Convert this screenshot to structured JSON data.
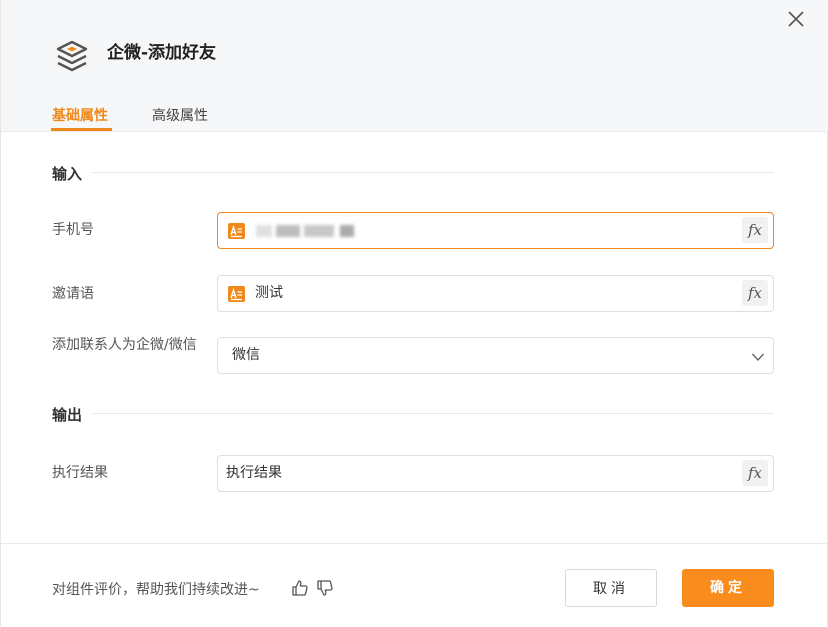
{
  "dialog": {
    "title": "企微-添加好友",
    "tabs": [
      {
        "label": "基础属性",
        "active": true
      },
      {
        "label": "高级属性",
        "active": false
      }
    ]
  },
  "input_section": {
    "title": "输入",
    "fields": [
      {
        "label": "手机号",
        "value": "",
        "redacted": true
      },
      {
        "label": "邀请语",
        "value": "测试"
      },
      {
        "label": "添加联系人为企微/微信",
        "selected": "微信"
      }
    ]
  },
  "output_section": {
    "title": "输出",
    "fields": [
      {
        "label": "执行结果",
        "value": "执行结果"
      }
    ]
  },
  "fx_label": "fx",
  "footer": {
    "feedback_text": "对组件评价，帮助我们持续改进~",
    "cancel_label": "取消",
    "ok_label": "确定"
  },
  "colors": {
    "accent": "#f0891c",
    "primary_button": "#f88c1c",
    "header_bg": "#f6f7f9"
  },
  "icons": [
    "close-icon",
    "layers-icon",
    "text-variable-icon",
    "chevron-down-icon",
    "thumbs-up-icon",
    "thumbs-down-icon"
  ]
}
